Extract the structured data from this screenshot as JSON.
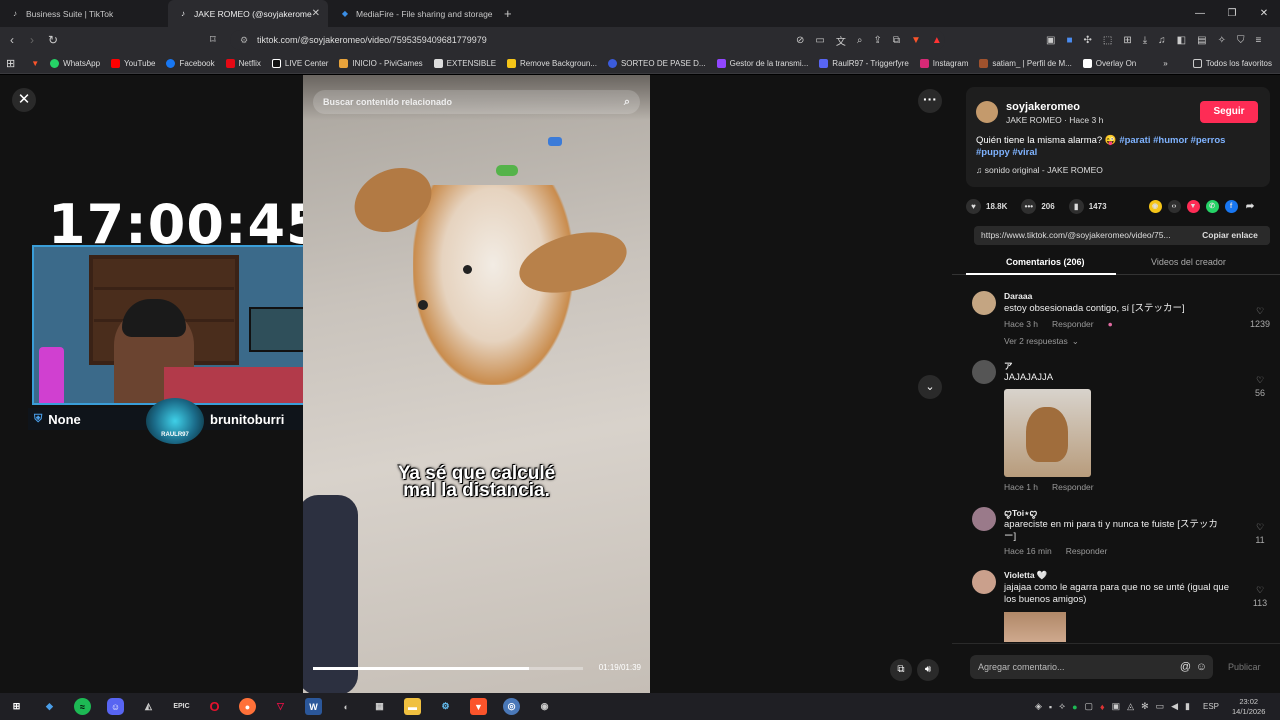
{
  "browser": {
    "tabs": [
      {
        "title": "Business Suite | TikTok",
        "active": false
      },
      {
        "title": "JAKE ROMEO (@soyjakerome",
        "active": true
      },
      {
        "title": "MediaFire - File sharing and storage",
        "active": false
      }
    ],
    "url": "tiktok.com/@soyjakeromeo/video/7595359409681779979",
    "bookmarks": [
      "WhatsApp",
      "YouTube",
      "Facebook",
      "Netflix",
      "LIVE Center",
      "INICIO - PiviGames",
      "EXTENSIBLE",
      "Remove Backgroun...",
      "SORTEO DE PASE D...",
      "Gestor de la transmi...",
      "RaulR97 - Triggerfyre",
      "Instagram",
      "satiam_ | Perfil de M...",
      "Overlay On"
    ],
    "all_favorites": "Todos los favoritos"
  },
  "stream_overlay": {
    "clock": "17:00:45",
    "left_name": "None",
    "right_name": "brunitoburri",
    "logo_text": "RAULR97"
  },
  "video": {
    "search_placeholder": "Buscar contenido relacionado",
    "subtitle_line1": "Ya sé que calculé",
    "subtitle_line2": "mal la distancia.",
    "timecode": "01:19/01:39",
    "progress": 0.8
  },
  "creator": {
    "username": "soyjakeromeo",
    "meta": "JAKE ROMEO · Hace 3 h",
    "follow_label": "Seguir",
    "caption": "Quién tiene la misma alarma? 😜",
    "hashtags": "#parati #humor #perros #puppy #viral",
    "sound": "sonido original - JAKE ROMEO"
  },
  "stats": {
    "likes": "18.8K",
    "comments": "206",
    "saves": "1473"
  },
  "link": {
    "url": "https://www.tiktok.com/@soyjakeromeo/video/75...",
    "copy_label": "Copiar enlace"
  },
  "comment_tabs": {
    "comments": "Comentarios (206)",
    "creator_videos": "Videos del creador"
  },
  "comments": [
    {
      "name": "Daraaa",
      "text": "estoy obsesionada contigo, sí [ステッカー]",
      "time": "Hace 3 h",
      "reply": "Responder",
      "likes": "1239",
      "replies": "Ver 2 respuestas"
    },
    {
      "name": "ア",
      "text": "JAJAJAJJA",
      "time": "Hace 1 h",
      "reply": "Responder",
      "likes": "56"
    },
    {
      "name": "ꨄ︎Toi⋆ꨄ︎",
      "text": "apareciste en mi para ti y nunca te fuiste [ステッカー]",
      "time": "Hace 16 min",
      "reply": "Responder",
      "likes": "11"
    },
    {
      "name": "Violetta 🤍",
      "text": "jajajaa como le agarra para que no se unté (igual que los buenos amigos)",
      "likes": "113"
    }
  ],
  "composer": {
    "placeholder": "Agregar comentario...",
    "publish": "Publicar"
  },
  "system": {
    "lang": "ESP",
    "time": "23:02",
    "date": "14/1/2026"
  }
}
